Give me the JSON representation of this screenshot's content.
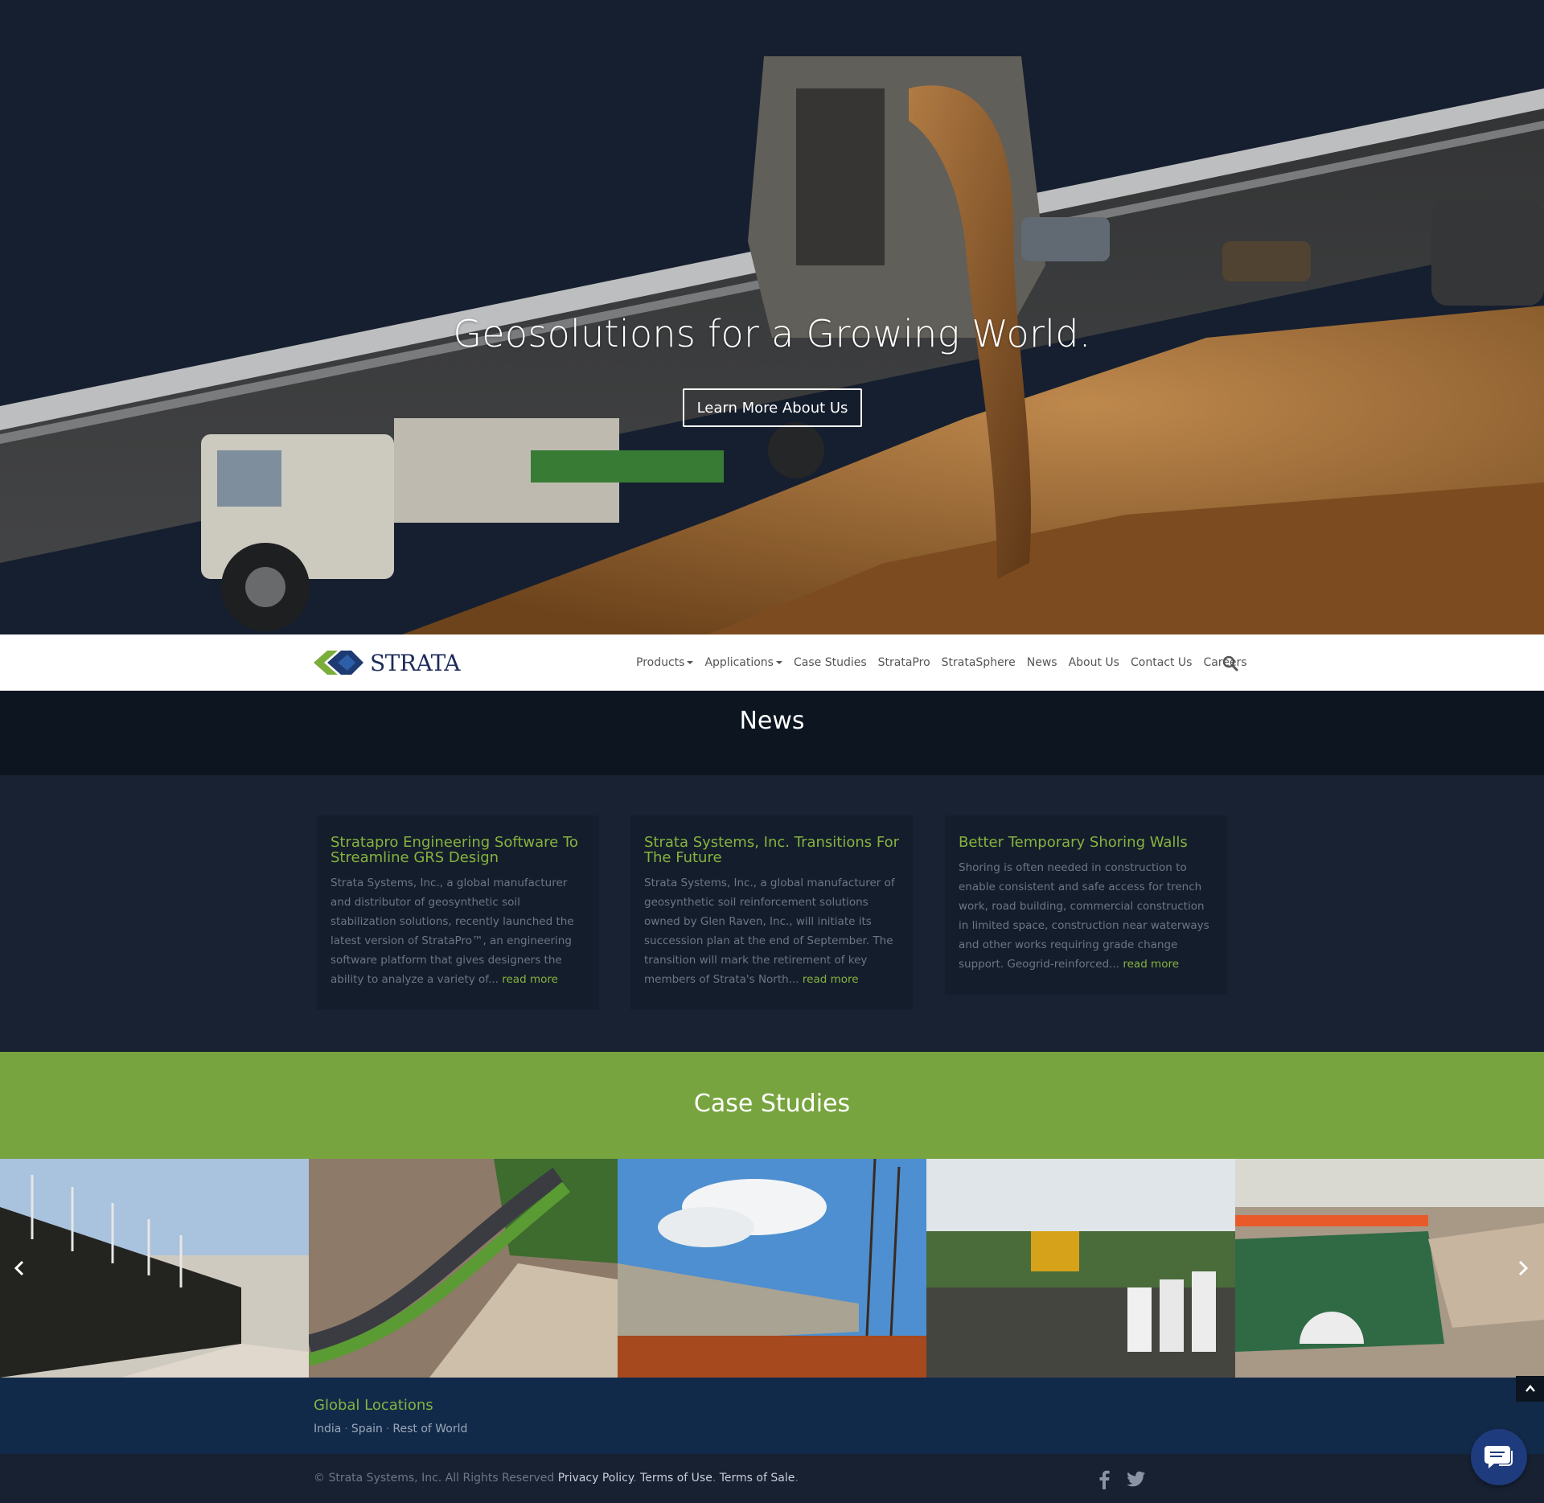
{
  "hero": {
    "title": "Geosolutions for a Growing World.",
    "button_label": "Learn More About Us"
  },
  "nav": {
    "logo_text": "STRATA",
    "items": [
      "Products",
      "Applications",
      "Case Studies",
      "StrataPro",
      "StrataSphere",
      "News",
      "About Us",
      "Contact Us",
      "Careers"
    ]
  },
  "news": {
    "heading": "News",
    "read_more": "read more",
    "articles": [
      {
        "title": "Stratapro Engineering Software To Streamline GRS Design",
        "excerpt": "Strata Systems, Inc., a global manufacturer and distributor of geosynthetic soil stabilization solutions, recently launched the latest version of StrataPro™, an engineering software platform that gives designers the ability to analyze a variety of..."
      },
      {
        "title": "Strata Systems, Inc. Transitions For The Future",
        "excerpt": "Strata Systems, Inc., a global manufacturer of geosynthetic soil reinforcement solutions owned by Glen Raven, Inc., will initiate its succession plan at the end of September. The transition will mark the retirement of key members of Strata's North..."
      },
      {
        "title": "Better Temporary Shoring Walls",
        "excerpt": "Shoring is often needed in construction to enable consistent and safe access for trench work, road building, commercial construction in limited space, construction near waterways and other works requiring grade change support. Geogrid-reinforced..."
      }
    ]
  },
  "case_studies": {
    "heading": "Case Studies"
  },
  "footer": {
    "locations_title": "Global Locations",
    "locations": [
      "India",
      "Spain",
      "Rest of World"
    ],
    "copyright": "© Strata Systems, Inc. All Rights Reserved",
    "links": [
      "Privacy Policy",
      "Terms of Use",
      "Terms of Sale"
    ]
  },
  "colors": {
    "accent_green": "#78a43f",
    "text_green": "#86b340",
    "navy": "#122a4a",
    "dark_bg": "#182233"
  },
  "icons": {
    "search": "search-icon",
    "facebook": "facebook-icon",
    "twitter": "twitter-icon",
    "chat": "chat-icon",
    "scroll_top": "chevron-up-icon"
  }
}
